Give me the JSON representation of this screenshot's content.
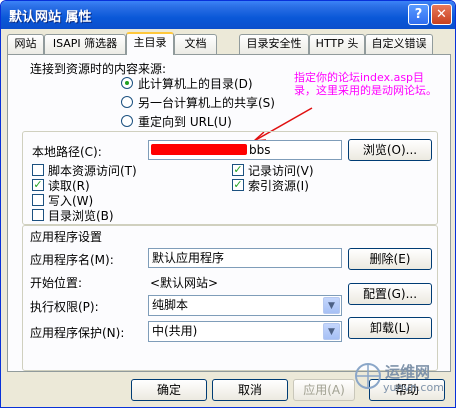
{
  "window": {
    "title": "默认网站 属性",
    "help": "?",
    "close": "✕"
  },
  "tabs": [
    {
      "label": "网站"
    },
    {
      "label": "ISAPI 筛选器"
    },
    {
      "label": "主目录"
    },
    {
      "label": "文档"
    },
    {
      "label": "目录安全性"
    },
    {
      "label": "HTTP 头"
    },
    {
      "label": "自定义错误"
    }
  ],
  "source": {
    "heading": "连接到资源时的内容来源:",
    "options": [
      {
        "label": "此计算机上的目录(D)",
        "selected": true
      },
      {
        "label": "另一台计算机上的共享(S)",
        "selected": false
      },
      {
        "label": "重定向到 URL(U)",
        "selected": false
      }
    ]
  },
  "annotation": "指定你的论坛index.asp目录，这里采用的是动网论坛。",
  "local_path": {
    "label": "本地路径(C):",
    "value": "bbs",
    "browse": "浏览(O)..."
  },
  "checks": [
    {
      "label": "脚本资源访问(T)",
      "checked": false
    },
    {
      "label": "读取(R)",
      "checked": true
    },
    {
      "label": "写入(W)",
      "checked": false
    },
    {
      "label": "目录浏览(B)",
      "checked": false
    },
    {
      "label": "记录访问(V)",
      "checked": true
    },
    {
      "label": "索引资源(I)",
      "checked": true
    }
  ],
  "app": {
    "heading": "应用程序设置",
    "name_label": "应用程序名(M):",
    "name_value": "默认应用程序",
    "remove": "删除(E)",
    "start_label": "开始位置:",
    "start_value": "<默认网站>",
    "config": "配置(G)...",
    "exec_label": "执行权限(P):",
    "exec_value": "纯脚本",
    "protect_label": "应用程序保护(N):",
    "protect_value": "中(共用)",
    "unload": "卸载(L)"
  },
  "footer": {
    "ok": "确定",
    "cancel": "取消",
    "apply": "应用(A)",
    "help": "帮助"
  },
  "watermark": {
    "line1": "运维网",
    "line2": "yunvn.com"
  }
}
